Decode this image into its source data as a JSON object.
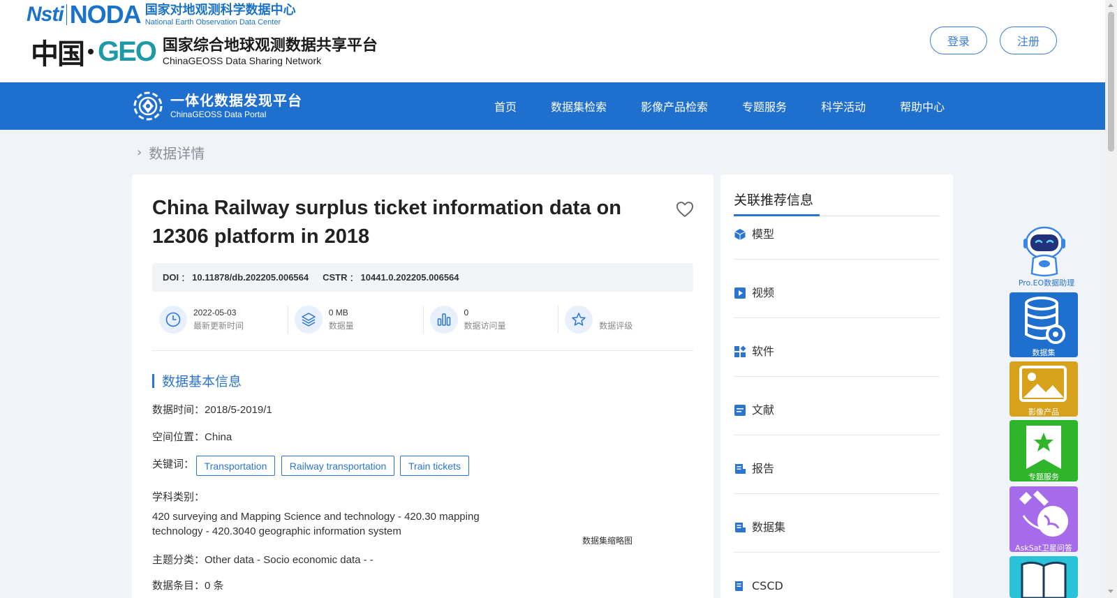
{
  "header": {
    "noda_logo": {
      "nsti": "Nsti",
      "noda": "NODA",
      "cn": "国家对地观测科学数据中心",
      "en": "National Earth Observation Data Center"
    },
    "geo_logo": {
      "prefix": "中国",
      "geo": "GEO",
      "cn": "国家综合地球观测数据共享平台",
      "en": "ChinaGEOSS Data Sharing Network"
    },
    "login_label": "登录",
    "register_label": "注册"
  },
  "nav": {
    "portal_cn": "一体化数据发现平台",
    "portal_en": "ChinaGEOSS Data Portal",
    "items": [
      "首页",
      "数据集检索",
      "影像产品检索",
      "专题服务",
      "科学活动",
      "帮助中心"
    ]
  },
  "breadcrumb": {
    "current": "数据详情"
  },
  "dataset": {
    "title": "China Railway surplus ticket information data on 12306 platform in 2018",
    "doi_label": "DOI",
    "doi": "10.11878/db.202205.006564",
    "cstr_label": "CSTR",
    "cstr": "10441.0.202205.006564",
    "colon": "：",
    "stats": [
      {
        "icon": "clock-icon",
        "value": "2022-05-03",
        "label": "最新更新时间"
      },
      {
        "icon": "layers-icon",
        "value": "0 MB",
        "label": "数据量"
      },
      {
        "icon": "bar-chart-icon",
        "value": "0",
        "label": "数据访问量"
      },
      {
        "icon": "star-icon",
        "value": "",
        "label": "数据评级"
      }
    ],
    "section_title": "数据基本信息",
    "time_label": "数据时间：",
    "time_value": "2018/5-2019/1",
    "location_label": "空间位置：",
    "location_value": "China",
    "keywords_label": "关键词：",
    "keywords": [
      "Transportation",
      "Railway transportation",
      "Train tickets"
    ],
    "subject_label": "学科类别：",
    "subject_value": "420 surveying and Mapping Science and technology - 420.30 mapping technology - 420.3040 geographic information system",
    "topic_label": "主题分类：",
    "topic_value": "Other data - Socio economic data - -",
    "count_label": "数据条目：",
    "count_value": "0 条",
    "thumbnail_caption": "数据集缩略图"
  },
  "side": {
    "title": "关联推荐信息",
    "items": [
      {
        "icon": "cube-icon",
        "label": "模型"
      },
      {
        "icon": "video-icon",
        "label": "视频"
      },
      {
        "icon": "apps-icon",
        "label": "软件"
      },
      {
        "icon": "document-icon",
        "label": "文献"
      },
      {
        "icon": "report-icon",
        "label": "报告"
      },
      {
        "icon": "dataset-icon",
        "label": "数据集"
      },
      {
        "icon": "cscd-icon",
        "label": "CSCD"
      }
    ]
  },
  "widgets": {
    "assistant_label": "Pro.EO数据助理",
    "dataset_label": "数据集",
    "image_label": "影像产品",
    "topic_label": "专题服务",
    "asksat_label": "AskSat卫星问答"
  },
  "colors": {
    "primary": "#1f6fcf",
    "accent": "#2b75d1",
    "image_widget": "#d8a11c",
    "topic_widget": "#2eb52a",
    "asksat_widget": "#a66bea"
  }
}
